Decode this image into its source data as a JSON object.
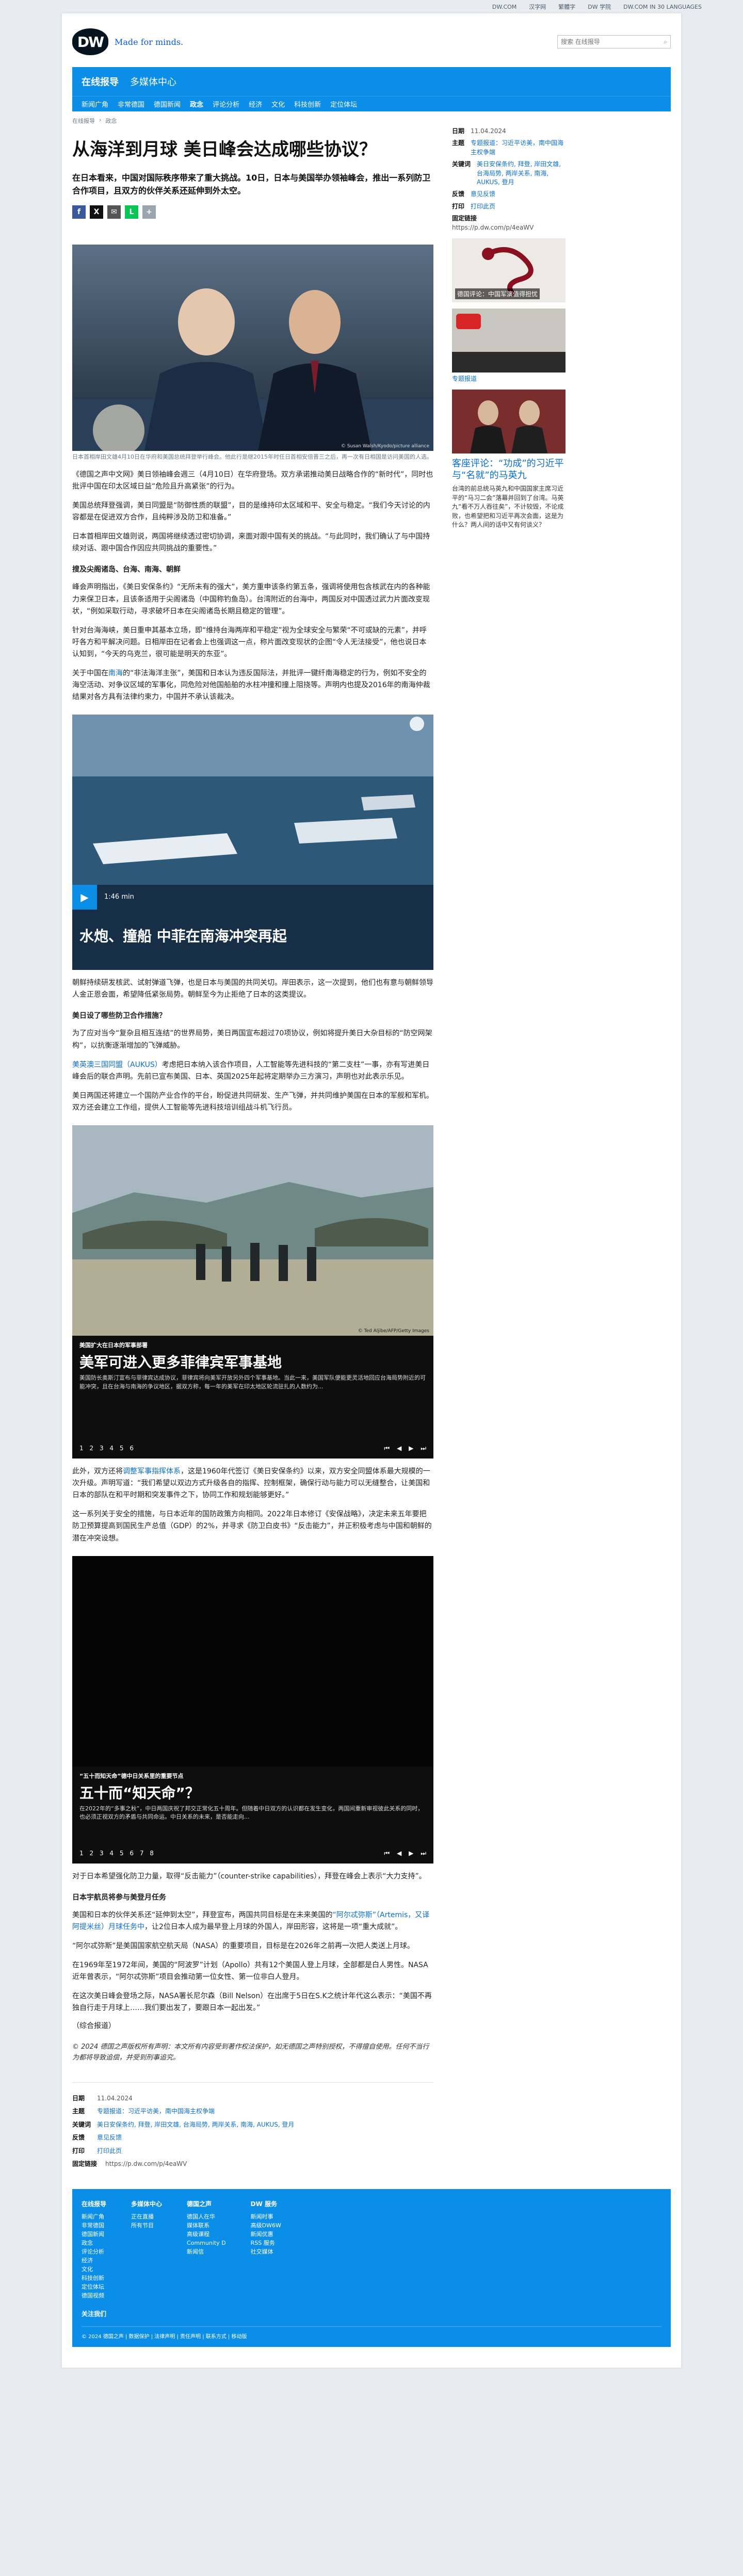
{
  "topstrip": [
    "DW.COM",
    "汉字网",
    "繁體字",
    "DW 学院",
    "DW.COM IN 30 LANGUAGES"
  ],
  "header": {
    "logo": "DW",
    "slogan": "Made for minds.",
    "search_placeholder": "搜索 在线报导"
  },
  "nav": {
    "main": [
      "在线报导",
      "多媒体中心"
    ],
    "sub": [
      "新闻广角",
      "非常德国",
      "德国新闻",
      "政念",
      "评论分析",
      "经济",
      "文化",
      "科技创新",
      "定位体坛"
    ]
  },
  "breadcrumb": [
    "在线报导",
    "政念"
  ],
  "article": {
    "title": "从海洋到月球 美日峰会达成哪些协议？",
    "lead": "在日本看来，中国对国际秩序带来了重大挑战。10日，日本与美国举办领袖峰会，推出一系列防卫合作项目，且双方的伙伴关系还延伸到外太空。",
    "share": [
      "f",
      "X",
      "✉",
      "L",
      "+"
    ],
    "image_caption": "日本首相岸田文雄4月10日在华府和美国总统拜登举行峰会。他此行是继2015年时任日首相安倍晋三之后，再一次有日相国是访问美国的人选。",
    "image_credit": "© Susan Walsh/Kyodo/picture alliance",
    "p1": "《德国之声中文网》美日领袖峰会週三（4月10日）在华府登场。双方承诺推动美日战略合作的“新时代”，同时也批评中国在印太区域日益“危险且升高紧张”的行为。",
    "p2": "美国总统拜登强调，美日同盟是“防御性质的联盟”，目的是维持印太区域和平、安全与稳定。“我们今天讨论的内容都是在促进双方合作，且纯粹涉及防卫和准备。”",
    "p3": "日本首相岸田文雄则说，两国将继续透过密切协调，来面对跟中国有关的挑战。“与此同时，我们确认了与中国持续对话、跟中国合作因应共同挑战的重要性。”",
    "h_sea": "搜及尖阁诸岛、台海、南海、朝鲜",
    "p4": "峰会声明指出，《美日安保条约》“无所未有的强大”，美方重申该条约第五条，强调将使用包含核武在内的各种能力来保卫日本，且该条适用于尖阁诸岛（中国称钓鱼岛）。台湾附近的台海中，两国反对中国透过武力片面改变现状，“例如采取行动，寻求破坏日本在尖阁诸岛长期且稳定的管理”。",
    "p5": "针对台海海峡，美日重申其基本立场，即“维持台海两岸和平稳定”视为全球安全与繁荣“不可或缺的元素”，并呼吁各方和平解决问题。日相岸田在记者会上也强调这一点，称片面改变现状的企图“令人无法接受”，他也说日本认知到，“今天的乌克兰，很可能是明天的东亚”。",
    "p6_pre": "关于中国在",
    "p6_link": "南海",
    "p6_post": "的“非法海洋主张”，美国和日本认为违反国际法，并批评一键纤南海稳定的行为，例如不安全的海空活动、对争议区域的军事化，同危险对他国船舶的水柱冲撞和撞上阻挠等。声明内也提及2016年的南海仲裁结果对各方具有法律约束力，中国并不承认该裁决。",
    "video_title": "水炮、撞船 中菲在南海冲突再起",
    "video_duration": "1:46 min",
    "p7": "朝鲜持续研发核武、试射弹道飞弹，也是日本与美国的共同关切。岸田表示，这一次提到，他们也有意与朝鲜领导人金正恩会面，希望降低紧张局势。朝鲜至今为止拒绝了日本的这类提议。",
    "h_defense": "美日设了哪些防卫合作措施？",
    "p8": "为了应对当今“复杂且相互连结”的世界局势，美日两国宣布超过70项协议，例如将提升美日大杂目标的“防空网架构”，以抗衡逐渐增加的飞弹威胁。",
    "p9_link": "美英澳三国同盟（AUKUS）",
    "p9_post": "考虑把日本纳入该合作项目，人工智能等先进科技的“第二支柱”一事，亦有写进美日峰会后的联合声明。先前已宣布美国、日本、英国2025年起将定期举办三方演习，声明也对此表示乐见。",
    "p10": "美日两国还将建立一个国防产业合作的平台，盼促进共同研发、生产飞弹，并共同维护美国在日本的军舰和军机。双方还会建立工作组，提供人工智能等先进科技培训组战斗机飞行员。",
    "gal1": {
      "kicker": "美国扩大在日本的军事部署",
      "title": "美军可进入更多菲律宾军事基地",
      "desc": "美国防长奥斯汀宣布与菲律宾达成协议，菲律宾将向美军开放另外四个军事基地。当此一来，美国军队便能更灵活地回应台海局势附近的可能冲突，且在台海与南海的争议地区，据双方称，每一年的美军在印太地区轮流驻扎的人数约为...",
      "dots": [
        "1",
        "2",
        "3",
        "4",
        "5",
        "6"
      ],
      "credit": "© Ted Aljibe/AFP/Getty Images"
    },
    "p11_pre": "此外，双方还将",
    "p11_link": "调整军事指挥体系",
    "p11_post": "，这是1960年代签订《美日安保条约》以来，双方安全同盟体系最大规模的一次升级。声明写道：“我们希望以双边方式升级各自的指挥、控制框架，确保行动与能力可以无缝整合，让美国和日本的部队在和平时期和突发事件之下，协同工作和规划能够更好。”",
    "p12": "这一系列关于安全的措施，与日本近年的国防政策方向相同。2022年日本修订《安保战略》，决定未来五年要把防卫预算提高到国民生产总值（GDP）的2%，并寻求《防卫白皮书》“反击能力”，并正积极考虑与中国和朝鲜的潜在冲突设想。",
    "gal2": {
      "kicker": "“五十而知天命”德中日关系里的重要节点",
      "title": "五十而“知天命”？",
      "desc": "在2022年的“多事之秋”，中日两国庆祝了邦交正常化五十周年。但随着中日双方的认识都在发生变化，两国间重新审视彼此关系的同时，也必须正视双方的矛盾与共同命运。中日关系的未来，是否能走向...",
      "dots": [
        "1",
        "2",
        "3",
        "4",
        "5",
        "6",
        "7",
        "8"
      ]
    },
    "p13": "对于日本希望强化防卫力量，取得“反击能力”（counter-strike capabilities），拜登在峰会上表示“大力支持”。",
    "h_space": "日本宇航员将参与美登月任务",
    "p14_pre": "美国和日本的伙伴关系还“延伸到太空”，拜登宣布，两国共同目标是在未来美国的",
    "p14_link": "“阿尔忒弥斯”（Artemis，又译阿提米丝）月球任务中",
    "p14_post": "，让2位日本人成为最早登上月球的外国人，岸田形容，这将是一项“重大成就”。",
    "p15": "“阿尔忒弥斯”是美国国家航空航天局（NASA）的重要项目，目标是在2026年之前再一次把人类送上月球。",
    "p16": "在1969年至1972年间，美国的“阿波罗”计划（Apollo）共有12个美国人登上月球，全部都是白人男性。NASA近年曾表示，“阿尔忒弥斯”项目会推动第一位女性、第一位非白人登月。",
    "p17": "在这次美日峰会登场之际，NASA署长尼尔森（Bill Nelson）在出席于5日在S.K之统计年代这么表示：“美国不再独自行走于月球上……我们要出发了，要跟日本一起出发。”",
    "author": "（综合报道）",
    "copyright": "© 2024 德国之声版权所有声明：本文所有内容受到著作权法保护，如无德国之声特别授权，不得擅自使用。任何不当行为都将导致追偿，并受到刑事追究。"
  },
  "side": {
    "date_label": "日期",
    "date": "11.04.2024",
    "topic_label": "主题",
    "topic": [
      "专题报道：习近平访美，南中国海主权争端"
    ],
    "keywords_label": "关键词",
    "keywords": "美日安保条约, 拜登, 岸田文雄, 台海局势, 两岸关系, 南海, AUKUS, 登月",
    "feedback_label": "反馈",
    "feedback": "意见反馈",
    "print_label": "打印",
    "print": "打印此页",
    "permalink_label": "固定链接",
    "permalink": "https://p.dw.com/p/4eaWV",
    "card1": "德国评论：中国军演值得担忧",
    "card2": "专题报道",
    "card3_title": "客座评论：“功成”的习近平与“名就”的马英九",
    "card3_desc": "台湾的前总统马英九和中国国家主席习近平的“马习二会”落幕并回到了台湾。马英九“看不万人吞往矣”，不计较毁，不论成败，也希望把和习近平再次会面，这是为什么？两人间的话中又有何谈义？"
  },
  "bottom_meta": {
    "date": "11.04.2024",
    "topic": "专题报道：习近平访美，南中国海主权争端",
    "keywords": "美日安保条约, 拜登, 岸田文雄, 台海局势, 两岸关系, 南海, AUKUS, 登月",
    "feedback": "意见反馈",
    "print": "打印此页",
    "permalink": "https://p.dw.com/p/4eaWV"
  },
  "footer": {
    "cols": [
      {
        "head": "在线报导",
        "items": [
          "新闻广角",
          "非常德国",
          "德国新闻",
          "政念",
          "评论分析",
          "经济",
          "文化",
          "科技创新",
          "定位体坛",
          "德国视频"
        ]
      },
      {
        "head": "多媒体中心",
        "items": [
          "正在直播",
          "所有节目"
        ]
      },
      {
        "head": "德国之声",
        "items": [
          "德国人在华",
          "媒体联系",
          "高级课程",
          "Community D",
          "新闻信"
        ]
      },
      {
        "head": "DW 服务",
        "items": [
          "新闻时事",
          "高级DW6W",
          "新闻优惠",
          "RSS 服务",
          "社交媒体"
        ]
      }
    ],
    "legal": [
      "© 2024 德国之声",
      "数据保护",
      "法律声明",
      "责任声明",
      "联系方式",
      "移动版"
    ],
    "follow": "关注我们"
  }
}
